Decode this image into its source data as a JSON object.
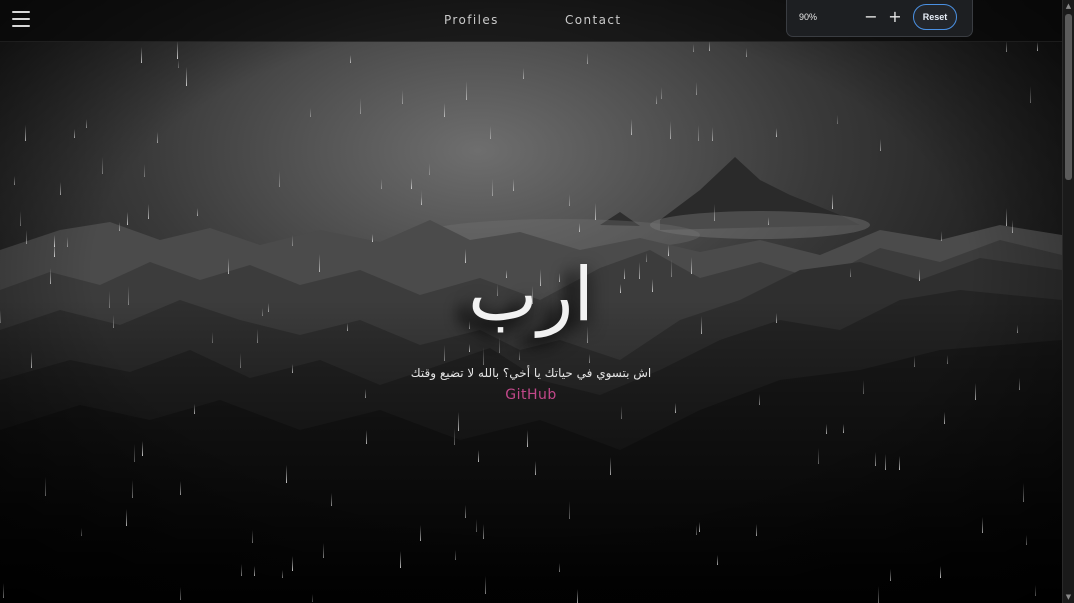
{
  "nav": {
    "profiles_label": "Profiles",
    "contact_label": "Contact"
  },
  "zoom": {
    "level": "90%",
    "minus_label": "−",
    "plus_label": "+",
    "reset_label": "Reset"
  },
  "hero": {
    "title": "ارب",
    "subtitle": "اش بتسوي في حياتك يا أخي؟ بالله لا تضيع وقتك",
    "link_label": "GitHub"
  },
  "colors": {
    "accent_link": "#c2488a",
    "reset_border": "#4a90e2"
  },
  "icons": {
    "menu": "hamburger-icon",
    "scroll_up": "arrow-up-icon",
    "scroll_down": "arrow-down-icon"
  }
}
